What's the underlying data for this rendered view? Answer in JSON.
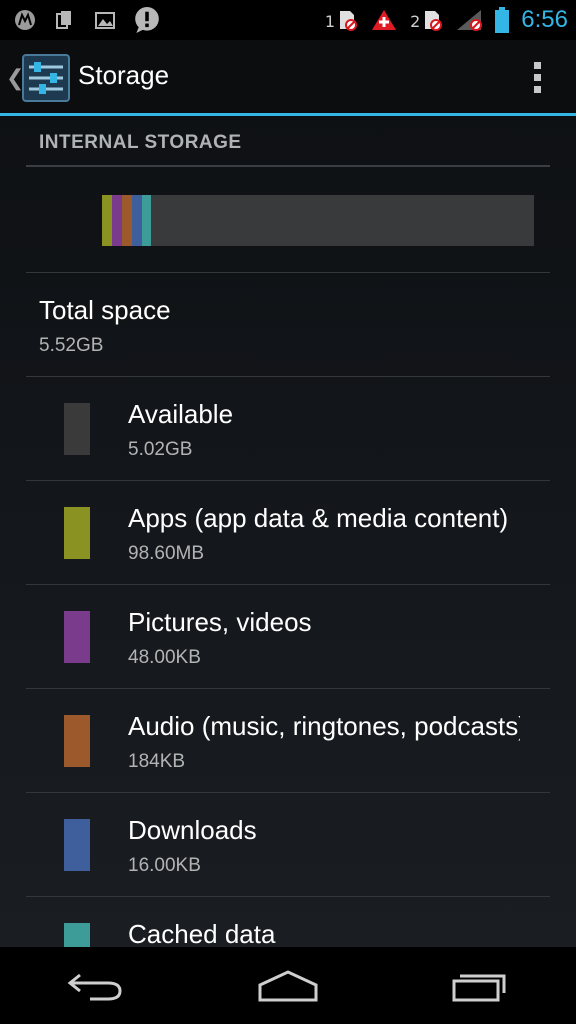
{
  "status_bar": {
    "sim1_label": "1",
    "sim2_label": "2",
    "time": "6:56",
    "icons": [
      "motorola-icon",
      "sim-toolkit-icon",
      "photo-notification-icon",
      "alert-icon",
      "sim-card-icon",
      "warning-plus-icon",
      "sim-card-icon",
      "signal-icon",
      "battery-icon"
    ]
  },
  "action_bar": {
    "title": "Storage",
    "icons": [
      "up-caret-icon",
      "settings-app-icon",
      "overflow-menu-icon"
    ]
  },
  "storage": {
    "section_title": "INTERNAL STORAGE",
    "total": {
      "label": "Total space",
      "value": "5.52GB"
    },
    "items": [
      {
        "label": "Available",
        "value": "5.02GB",
        "color": "#3a3a3a"
      },
      {
        "label": "Apps (app data & media content)",
        "value": "98.60MB",
        "color": "#8a9221"
      },
      {
        "label": "Pictures, videos",
        "value": "48.00KB",
        "color": "#7b3b8c"
      },
      {
        "label": "Audio (music, ringtones, podcasts)",
        "value": "184KB",
        "color": "#9c5a2c"
      },
      {
        "label": "Downloads",
        "value": "16.00KB",
        "color": "#3e5e9c"
      },
      {
        "label": "Cached data",
        "value": "",
        "color": "#3e9c98"
      }
    ],
    "bar_segments": [
      {
        "name": "apps",
        "color": "#8a9221"
      },
      {
        "name": "pictures",
        "color": "#7b3b8c"
      },
      {
        "name": "audio",
        "color": "#9c5a2c"
      },
      {
        "name": "downloads",
        "color": "#3e5e9c"
      },
      {
        "name": "cached",
        "color": "#3e9c98"
      }
    ]
  },
  "nav_bar": {
    "icons": [
      "back-icon",
      "home-icon",
      "recent-apps-icon"
    ]
  }
}
